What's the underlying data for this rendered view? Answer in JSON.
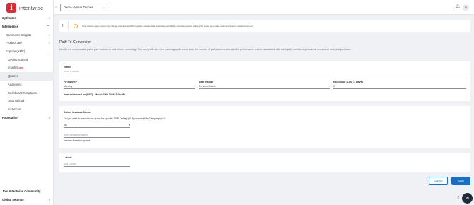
{
  "brand": {
    "name": "intentwise",
    "logo_letter": "i"
  },
  "sidebar": {
    "items": [
      {
        "label": "Optimizer",
        "level": "top"
      },
      {
        "label": "Intelligence",
        "level": "top"
      },
      {
        "label": "Commerce Insights",
        "level": "sub"
      },
      {
        "label": "Product 360",
        "level": "sub"
      },
      {
        "label": "Explore (AMC)",
        "level": "sub"
      },
      {
        "label": "Getting Started",
        "level": "subsub"
      },
      {
        "label": "Insights",
        "level": "subsub",
        "badge": "NEW"
      },
      {
        "label": "Queries",
        "level": "subsub",
        "active": true
      },
      {
        "label": "Audiences",
        "level": "subsub"
      },
      {
        "label": "Dashboard Templates",
        "level": "subsub"
      },
      {
        "label": "Data Upload",
        "level": "subsub"
      },
      {
        "label": "Instances",
        "level": "subsub"
      },
      {
        "label": "Foundation",
        "level": "top"
      }
    ],
    "bottom": [
      {
        "label": "Join Intentwise Community"
      },
      {
        "label": "Global Settings"
      }
    ]
  },
  "header": {
    "client_select_value": "Demo - Wiser Drones",
    "avatar_initials": "M"
  },
  "notice": {
    "text": "Note that the query output may change over time as AMC regularly restates data. Intentwise periodically refreshes queries to keep the output up-to-date. Learn more about restatement ",
    "link_text": "here."
  },
  "page": {
    "title": "Path To Conversion",
    "description": "Identify the most popular paths your customers took before converting. This query will return the campaign path users took, the number of path occurrences, and the performance metrics associated with each path, such as impressions, impression cost, and purchase."
  },
  "form": {
    "name_label": "Name",
    "name_placeholder": "Enter a name",
    "frequency_label": "Frequency",
    "frequency_value": "Monthly",
    "date_range_label": "Date Range",
    "date_range_value": "Previous Month",
    "exclusion_label": "Exclusion (Last X Days)",
    "exclusion_value": "0",
    "next_scheduled": "Next scheduled on (PST) - March 25th 2026, 9:00 PM"
  },
  "instance": {
    "section_label": "Select Instance Name",
    "question": "Do you want to execute the query for specific DSP Order(s) & Sponsored Ads Campaign(s)?",
    "answer_value": "No",
    "instance_placeholder": "Select Instance Name",
    "error": "Instance Name is required"
  },
  "labels": {
    "section_label": "Labels",
    "placeholder": "Add Labels"
  },
  "actions": {
    "cancel": "Cancel",
    "save": "Save"
  },
  "icons": [
    "chevron-right-icon",
    "chevron-down-icon",
    "bell-icon",
    "back-arrow-icon",
    "info-icon",
    "chat-icon",
    "grid-icon"
  ],
  "colors": {
    "brand_red": "#e02b36",
    "primary_blue": "#1b6ec2",
    "warning_orange": "#f0a32a"
  }
}
